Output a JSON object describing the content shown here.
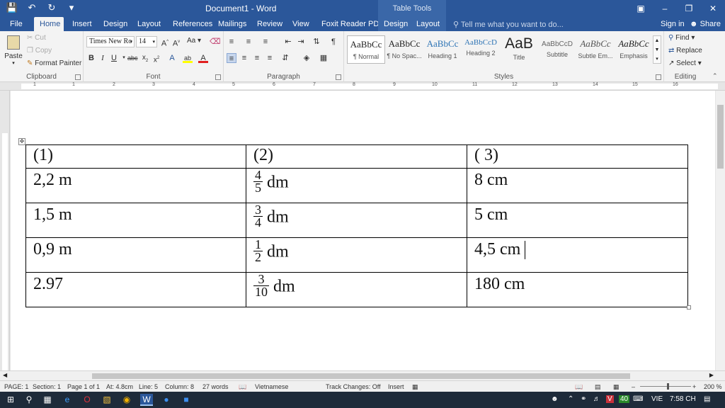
{
  "window": {
    "title": "Document1 - Word",
    "context_tab_group": "Table Tools",
    "qat": {
      "save_icon": "save-icon",
      "undo_icon": "undo-icon",
      "redo_icon": "redo-icon"
    }
  },
  "tabs": [
    "File",
    "Home",
    "Insert",
    "Design",
    "Layout",
    "References",
    "Mailings",
    "Review",
    "View",
    "Foxit Reader PDF"
  ],
  "table_tools_tabs": [
    "Design",
    "Layout"
  ],
  "tell_me": "Tell me what you want to do...",
  "sign_in": "Sign in",
  "share": "Share",
  "clipboard": {
    "label": "Clipboard",
    "paste": "Paste",
    "cut": "Cut",
    "copy": "Copy",
    "format_painter": "Format Painter"
  },
  "font": {
    "label": "Font",
    "name": "Times New Ro",
    "size": "14",
    "case_btn": "Aa"
  },
  "paragraph": {
    "label": "Paragraph"
  },
  "styles": {
    "label": "Styles",
    "items": [
      {
        "preview": "AaBbCc",
        "name": "¶ Normal"
      },
      {
        "preview": "AaBbCc",
        "name": "¶ No Spac..."
      },
      {
        "preview": "AaBbCc",
        "name": "Heading 1"
      },
      {
        "preview": "AaBbCcD",
        "name": "Heading 2"
      },
      {
        "preview": "AaB",
        "name": "Title"
      },
      {
        "preview": "AaBbCcD",
        "name": "Subtitle"
      },
      {
        "preview": "AaBbCc",
        "name": "Subtle Em..."
      },
      {
        "preview": "AaBbCc",
        "name": "Emphasis"
      }
    ]
  },
  "editing": {
    "label": "Editing",
    "find": "Find",
    "replace": "Replace",
    "select": "Select"
  },
  "table": {
    "headers": [
      "(1)",
      "(2)",
      "( 3)"
    ],
    "rows": [
      {
        "c1": "2,2 m",
        "num": "4",
        "den": "5",
        "unit": "dm",
        "c3": "8 cm"
      },
      {
        "c1": "1,5 m",
        "num": "3",
        "den": "4",
        "unit": "dm",
        "c3": "5 cm"
      },
      {
        "c1": "0,9 m",
        "num": "1",
        "den": "2",
        "unit": "dm",
        "c3": "4,5 cm"
      },
      {
        "c1": "2.97",
        "num": "3",
        "den": "10",
        "unit": "dm",
        "c3": "180 cm"
      }
    ]
  },
  "status": {
    "page": "PAGE: 1",
    "section": "Section: 1",
    "page_of": "Page 1 of 1",
    "at": "At: 4.8cm",
    "line": "Line: 5",
    "column": "Column: 8",
    "words": "27 words",
    "language": "Vietnamese",
    "track_changes": "Track Changes: Off",
    "insert": "Insert",
    "zoom": "200 %"
  },
  "taskbar": {
    "lang": "VIE",
    "time": "7:58 CH",
    "badge": "40"
  }
}
